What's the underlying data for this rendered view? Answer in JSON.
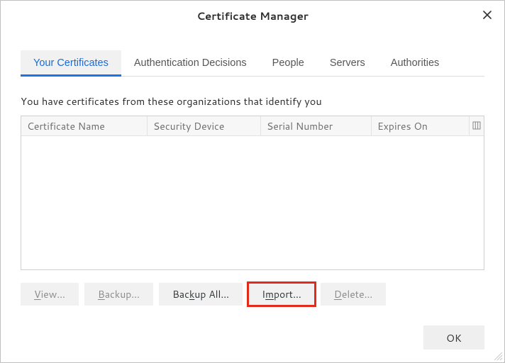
{
  "window": {
    "title": "Certificate Manager"
  },
  "tabs": [
    {
      "label": "Your Certificates",
      "active": true
    },
    {
      "label": "Authentication Decisions",
      "active": false
    },
    {
      "label": "People",
      "active": false
    },
    {
      "label": "Servers",
      "active": false
    },
    {
      "label": "Authorities",
      "active": false
    }
  ],
  "description": "You have certificates from these organizations that identify you",
  "columns": [
    "Certificate Name",
    "Security Device",
    "Serial Number",
    "Expires On"
  ],
  "rows": [],
  "buttons": {
    "view": {
      "pre": "",
      "key": "V",
      "post": "iew…",
      "enabled": false
    },
    "backup": {
      "pre": "",
      "key": "B",
      "post": "ackup…",
      "enabled": false
    },
    "backupAll": {
      "pre": "Bac",
      "key": "k",
      "post": "up All…",
      "enabled": true
    },
    "import": {
      "pre": "I",
      "key": "m",
      "post": "port…",
      "enabled": true,
      "highlighted": true
    },
    "delete": {
      "pre": "",
      "key": "D",
      "post": "elete…",
      "enabled": false
    }
  },
  "footer": {
    "ok": "OK"
  }
}
